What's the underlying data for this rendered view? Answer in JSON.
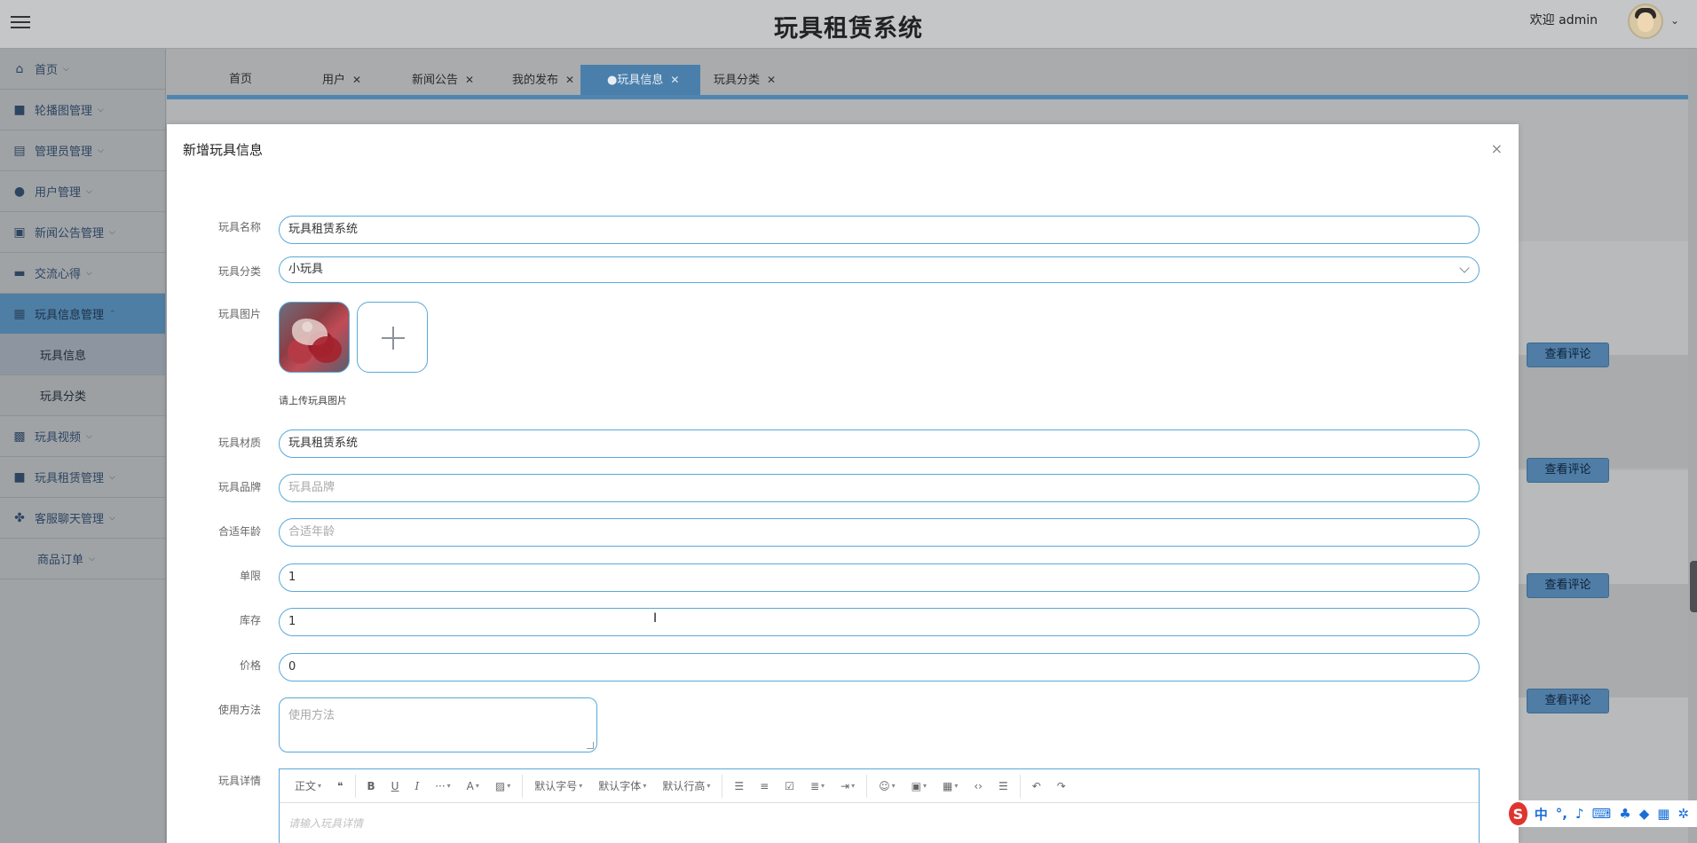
{
  "header": {
    "title": "玩具租赁系统",
    "welcome": "欢迎 admin"
  },
  "sidebar": {
    "items": [
      {
        "label": "首页",
        "icon": "home-icon"
      },
      {
        "label": "轮播图管理",
        "icon": "folder-icon"
      },
      {
        "label": "管理员管理",
        "icon": "table-icon"
      },
      {
        "label": "用户管理",
        "icon": "user-icon"
      },
      {
        "label": "新闻公告管理",
        "icon": "news-icon"
      },
      {
        "label": "交流心得",
        "icon": "briefcase-icon"
      },
      {
        "label": "玩具信息管理",
        "icon": "dashboard-icon"
      },
      {
        "label": "玩具视频",
        "icon": "grid-icon"
      },
      {
        "label": "玩具租赁管理",
        "icon": "folder-icon"
      },
      {
        "label": "客服聊天管理",
        "icon": "apps-icon"
      },
      {
        "label": "商品订单",
        "icon": ""
      }
    ],
    "subitems": [
      "玩具信息",
      "玩具分类"
    ]
  },
  "tabs": [
    {
      "label": "首页"
    },
    {
      "label": "用户"
    },
    {
      "label": "新闻公告"
    },
    {
      "label": "我的发布"
    },
    {
      "label": "●玩具信息"
    },
    {
      "label": "玩具分类"
    }
  ],
  "background": {
    "view_button_label": "查看评论"
  },
  "dialog": {
    "title": "新增玩具信息",
    "close": "×",
    "fields": {
      "name": {
        "label": "玩具名称",
        "value": "玩具租赁系统"
      },
      "category": {
        "label": "玩具分类",
        "value": "小玩具"
      },
      "image": {
        "label": "玩具图片",
        "tip": "请上传玩具图片"
      },
      "material": {
        "label": "玩具材质",
        "value": "玩具租赁系统"
      },
      "brand": {
        "label": "玩具品牌",
        "placeholder": "玩具品牌"
      },
      "age": {
        "label": "合适年龄",
        "placeholder": "合适年龄"
      },
      "limit": {
        "label": "单限",
        "value": "1"
      },
      "stock": {
        "label": "库存",
        "value": "1"
      },
      "price": {
        "label": "价格",
        "value": "0"
      },
      "usage": {
        "label": "使用方法",
        "placeholder": "使用方法"
      },
      "detail": {
        "label": "玩具详情",
        "placeholder": "请输入玩具详情"
      }
    },
    "toolbar": {
      "paragraph": "正文",
      "font_size": "默认字号",
      "font_family": "默认字体",
      "line_height": "默认行高"
    }
  },
  "ime": {
    "label": "中"
  }
}
